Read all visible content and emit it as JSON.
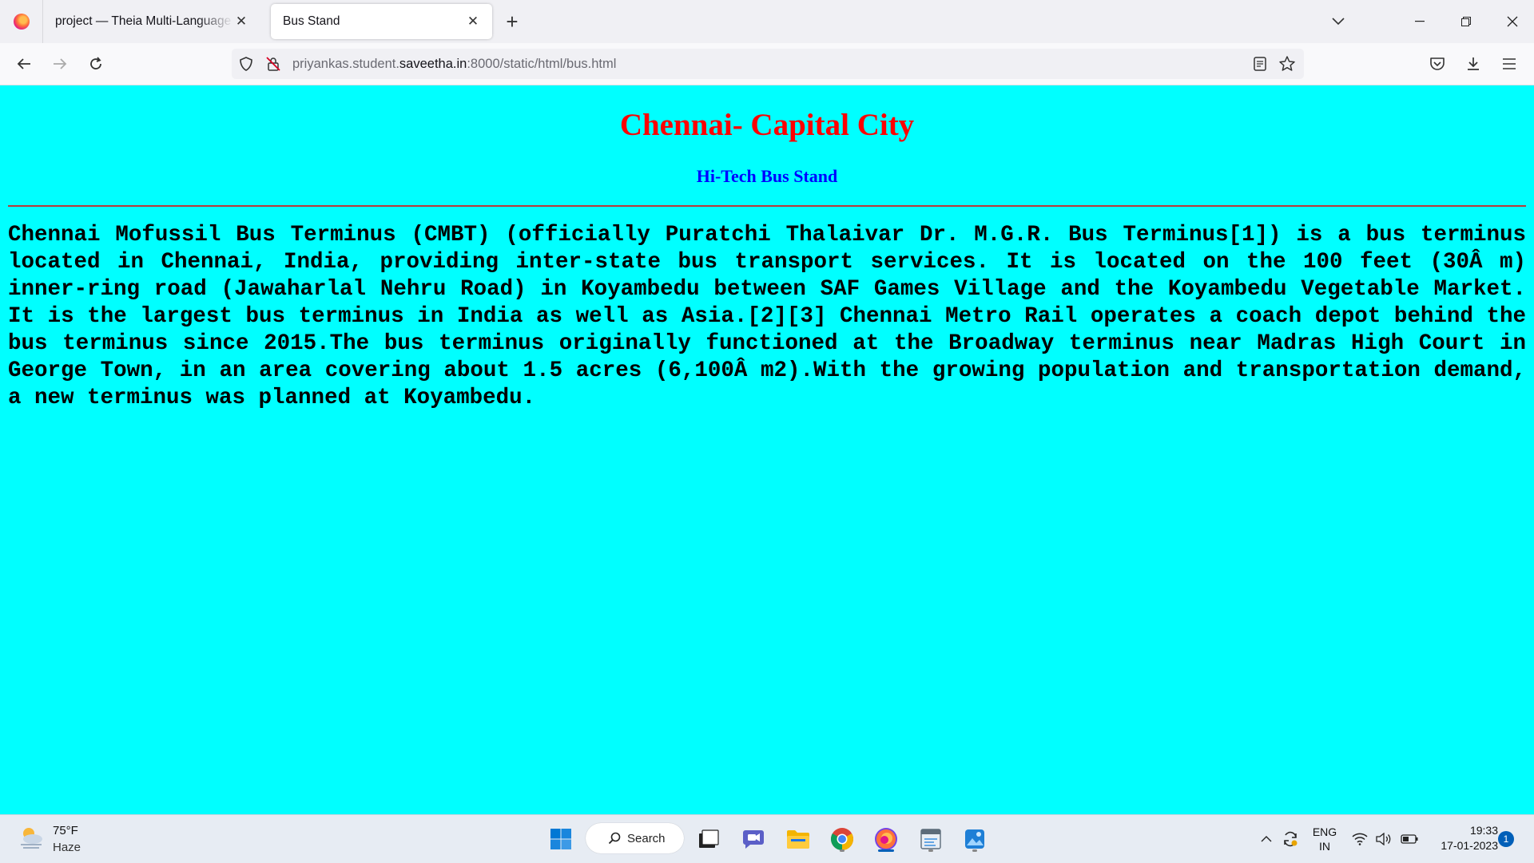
{
  "browser": {
    "tabs": [
      {
        "title": "project — Theia Multi-Language Ex",
        "active": false
      },
      {
        "title": "Bus Stand",
        "active": true
      }
    ],
    "url": {
      "prefix": "priyankas.student.",
      "domain": "saveetha.in",
      "suffix": ":8000/static/html/bus.html"
    }
  },
  "page": {
    "background": "#00ffff",
    "heading": "Chennai- Capital City",
    "heading_color": "#ff0000",
    "subheading": "Hi-Tech Bus Stand",
    "subheading_color": "#0000ff",
    "paragraph": "Chennai Mofussil Bus Terminus (CMBT) (officially Puratchi Thalaivar Dr. M.G.R. Bus Terminus[1]) is a bus terminus located in Chennai, India, providing inter-state bus transport services. It is located on the 100 feet (30Â m) inner-ring road (Jawaharlal Nehru Road) in Koyambedu between SAF Games Village and the Koyambedu Vegetable Market. It is the largest bus terminus in India as well as Asia.[2][3] Chennai Metro Rail operates a coach depot behind the bus terminus since 2015.The bus terminus originally functioned at the Broadway terminus near Madras High Court in George Town, in an area covering about 1.5 acres (6,100Â m2).With the growing population and transportation demand, a new terminus was planned at Koyambedu."
  },
  "taskbar": {
    "weather": {
      "temp": "75°F",
      "desc": "Haze"
    },
    "search_label": "Search",
    "lang": {
      "line1": "ENG",
      "line2": "IN"
    },
    "time": "19:33",
    "date": "17-01-2023",
    "notifications": "1"
  }
}
